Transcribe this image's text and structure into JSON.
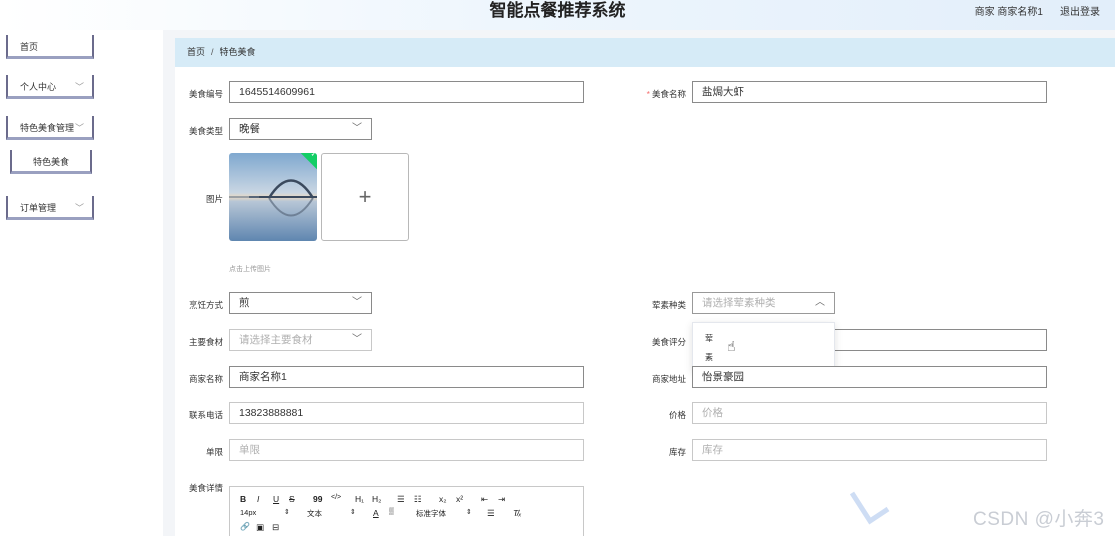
{
  "header": {
    "title": "智能点餐推荐系统",
    "user_text": "商家 商家名称1",
    "logout": "退出登录"
  },
  "sidebar": {
    "items": [
      {
        "label": "首页"
      },
      {
        "label": "个人中心",
        "chevron": "﹀"
      },
      {
        "label": "特色美食管理",
        "chevron": "﹀"
      },
      {
        "label": "特色美食"
      },
      {
        "label": "订单管理",
        "chevron": "﹀"
      }
    ]
  },
  "breadcrumb": {
    "home": "首页",
    "sep": "/",
    "current": "特色美食"
  },
  "form": {
    "food_no": {
      "label": "美食编号",
      "value": "1645514609961"
    },
    "food_name": {
      "label": "美食名称",
      "required": "*",
      "value": "盐焗大虾"
    },
    "food_type": {
      "label": "美食类型",
      "value": "晚餐"
    },
    "image": {
      "label": "图片",
      "plus": "+",
      "hint": "点击上传图片",
      "check": "✓"
    },
    "cook_method": {
      "label": "烹饪方式",
      "value": "煎"
    },
    "meat_veg": {
      "label": "荤素种类",
      "placeholder": "请选择荤素种类",
      "options": [
        "荤",
        "素"
      ]
    },
    "main_ingredient": {
      "label": "主要食材",
      "placeholder": "请选择主要食材"
    },
    "food_rating": {
      "label": "美食评分"
    },
    "merchant_name": {
      "label": "商家名称",
      "value": "商家名称1"
    },
    "merchant_address": {
      "label": "商家地址",
      "value": "怡景豪园"
    },
    "phone": {
      "label": "联系电话",
      "value": "13823888881"
    },
    "price": {
      "label": "价格",
      "placeholder": "价格"
    },
    "limit": {
      "label": "单限",
      "placeholder": "单限"
    },
    "stock": {
      "label": "库存",
      "placeholder": "库存"
    },
    "detail": {
      "label": "美食详情"
    }
  },
  "editor": {
    "row1": [
      "B",
      "I",
      "U",
      "S",
      "99",
      "</>",
      "H₁",
      "H₂",
      "☰",
      "☷",
      "x₂",
      "x²",
      "⇤",
      "⇥"
    ],
    "size": "14px",
    "para": "文本",
    "font": "标准字体",
    "row3": [
      "🔗",
      "▣",
      "⊟"
    ],
    "font_color": "A",
    "align": "☰",
    "clear": "T̸ₓ"
  },
  "watermark": "CSDN @小奔3"
}
